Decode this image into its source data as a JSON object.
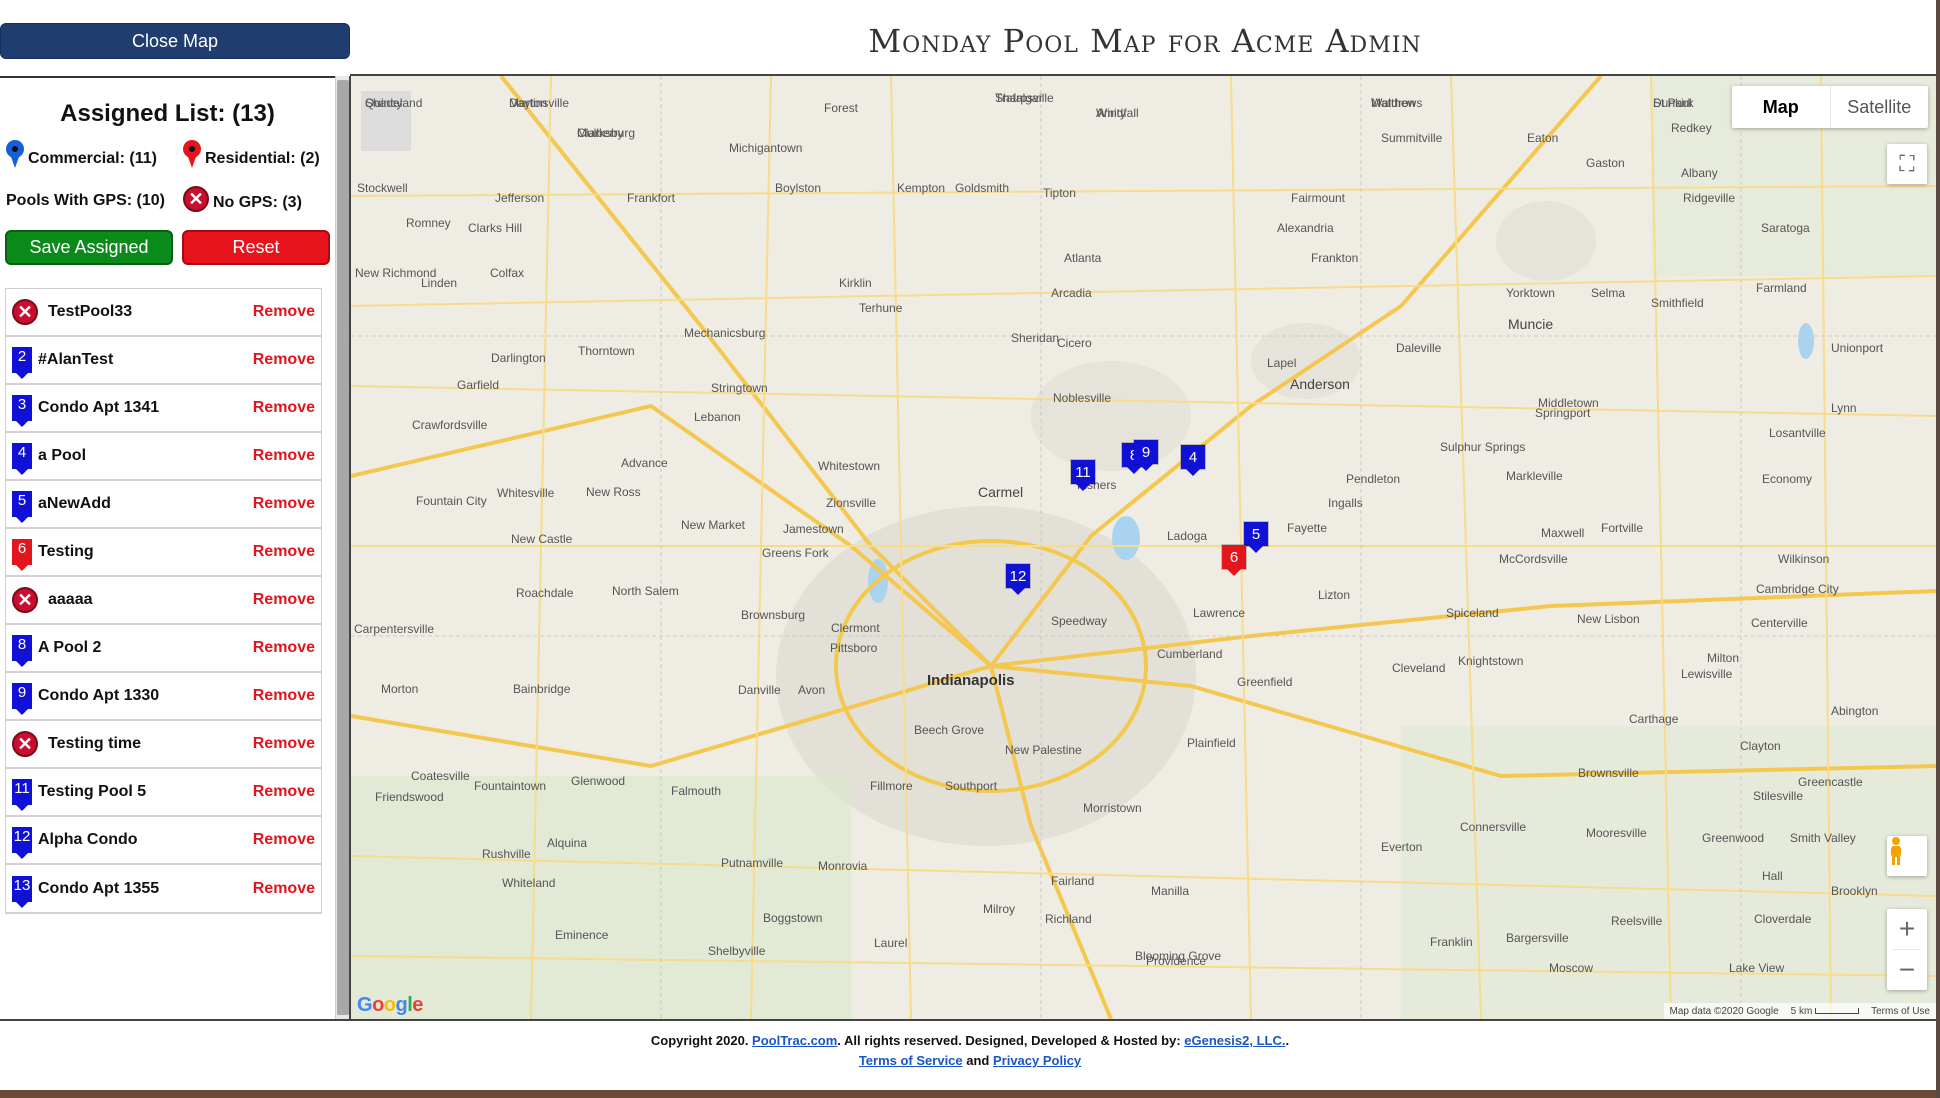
{
  "header": {
    "close_button": "Close Map",
    "title": "Monday Pool Map for Acme Admin"
  },
  "left_panel": {
    "assigned_title": "Assigned List: (13)",
    "commercial": "Commercial: (11)",
    "residential": "Residential: (2)",
    "with_gps": "Pools With GPS: (10)",
    "no_gps": "No GPS: (3)",
    "save_label": "Save Assigned",
    "reset_label": "Reset",
    "remove_label": "Remove",
    "items": [
      {
        "marker": "x",
        "name": "TestPool33"
      },
      {
        "marker": "2",
        "name": "#AlanTest",
        "color": "blue"
      },
      {
        "marker": "3",
        "name": "Condo Apt 1341",
        "color": "blue"
      },
      {
        "marker": "4",
        "name": "a Pool",
        "color": "blue"
      },
      {
        "marker": "5",
        "name": "aNewAdd",
        "color": "blue"
      },
      {
        "marker": "6",
        "name": "Testing",
        "color": "red"
      },
      {
        "marker": "x",
        "name": "aaaaa"
      },
      {
        "marker": "8",
        "name": "A Pool 2",
        "color": "blue"
      },
      {
        "marker": "9",
        "name": "Condo Apt 1330",
        "color": "blue"
      },
      {
        "marker": "x",
        "name": "Testing time"
      },
      {
        "marker": "11",
        "name": "Testing Pool 5",
        "color": "blue"
      },
      {
        "marker": "12",
        "name": "Alpha Condo",
        "color": "blue"
      },
      {
        "marker": "13",
        "name": "Condo Apt 1355",
        "color": "blue"
      }
    ]
  },
  "map": {
    "type_map": "Map",
    "type_satellite": "Satellite",
    "google": "Google",
    "attribution": "Map data ©2020 Google",
    "scale": "5 km",
    "terms": "Terms of Use",
    "zoom_in": "+",
    "zoom_out": "−",
    "fullscreen": "⛶",
    "markers": [
      {
        "label": "11",
        "color": "blue"
      },
      {
        "label": "8",
        "color": "blue"
      },
      {
        "label": "9",
        "color": "blue"
      },
      {
        "label": "4",
        "color": "blue"
      },
      {
        "label": "5",
        "color": "blue"
      },
      {
        "label": "6",
        "color": "red"
      },
      {
        "label": "12",
        "color": "blue"
      }
    ],
    "cities_big": [
      "Indianapolis",
      "Carmel",
      "Anderson",
      "Muncie"
    ],
    "cities": [
      "Shadeland",
      "Dayton",
      "Sharpsville",
      "Windfall",
      "Matthews",
      "Dunkirk",
      "Mulberry",
      "Forest",
      "Summitville",
      "Eaton",
      "Redkey",
      "Michigantown",
      "Gaston",
      "Albany",
      "Stockwell",
      "Jefferson",
      "Frankfort",
      "Boylston",
      "Kempton",
      "Goldsmith",
      "Tipton",
      "Fairmount",
      "Ridgeville",
      "Romney",
      "Clarks Hill",
      "Alexandria",
      "Saratoga",
      "Frankton",
      "Colfax",
      "Atlanta",
      "New Richmond",
      "Linden",
      "Kirklin",
      "Arcadia",
      "Yorktown",
      "Selma",
      "Smithfield",
      "Farmland",
      "Terhune",
      "Mechanicsburg",
      "Sheridan",
      "Daleville",
      "Thorntown",
      "Cicero",
      "Unionport",
      "Darlington",
      "Stringtown",
      "Lapel",
      "Garfield",
      "Noblesville",
      "Middletown",
      "Springport",
      "Lynn",
      "Crawfordsville",
      "Lebanon",
      "Losantville",
      "Fishers",
      "Pendleton",
      "Sulphur Springs",
      "Advance",
      "Whitestown",
      "Markleville",
      "Economy",
      "Whitesville",
      "New Ross",
      "Zionsville",
      "Ingalls",
      "Fountain City",
      "New Market",
      "Jamestown",
      "Fayette",
      "Fortville",
      "New Castle",
      "Ladoga",
      "McCordsville",
      "Wilkinson",
      "Greens Fork",
      "Lizton",
      "Maxwell",
      "Roachdale",
      "North Salem",
      "Brownsburg",
      "Lawrence",
      "Spiceland",
      "New Lisbon",
      "Cambridge City",
      "Centerville",
      "Carpentersville",
      "Pittsboro",
      "Clermont",
      "Speedway",
      "Cumberland",
      "Greenfield",
      "Cleveland",
      "Knightstown",
      "Lewisville",
      "Milton",
      "Morton",
      "Bainbridge",
      "Danville",
      "Avon",
      "Carthage",
      "Abington",
      "Beech Grove",
      "New Palestine",
      "Plainfield",
      "Clayton",
      "Coatesville",
      "Fountaintown",
      "Falmouth",
      "Fillmore",
      "Southport",
      "Morristown",
      "Brownsville",
      "Greencastle",
      "Stilesville",
      "Friendswood",
      "Glenwood",
      "Connersville",
      "Mooresville",
      "Smith Valley",
      "Greenwood",
      "Rushville",
      "Alquina",
      "Putnamville",
      "Monrovia",
      "Fairland",
      "Manilla",
      "Everton",
      "Hall",
      "Brooklyn",
      "Whiteland",
      "Boggstown",
      "Milroy",
      "Richland",
      "Reelsville",
      "Cloverdale",
      "Eminence",
      "Bargersville",
      "Shelbyville",
      "Laurel",
      "Blooming Grove",
      "Providence",
      "Franklin",
      "Moscow",
      "Lake View",
      "Quincy",
      "Martinsville",
      "Trafalgar",
      "Amity",
      "Waldron",
      "St Paul",
      "Clarksburg"
    ]
  }
}
